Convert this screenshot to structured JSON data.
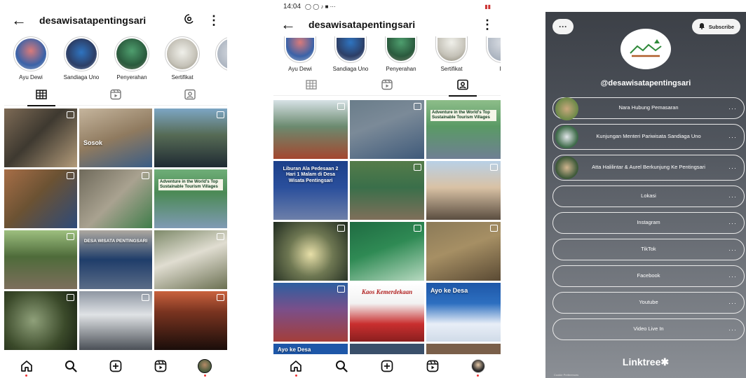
{
  "left_phone": {
    "username": "desawisatapentingsari",
    "highlights": [
      {
        "label": "Ayu Dewi"
      },
      {
        "label": "Sandiaga Uno"
      },
      {
        "label": "Penyerahan"
      },
      {
        "label": "Sertifikat"
      },
      {
        "label": "Pi"
      }
    ],
    "tabs": [
      {
        "icon": "grid-icon",
        "active": true
      },
      {
        "icon": "reels-icon",
        "active": false
      },
      {
        "icon": "tagged-icon",
        "active": false
      }
    ],
    "posts": [
      {
        "overlay": "",
        "caption": ""
      },
      {
        "overlay": "Sosok",
        "caption": ""
      },
      {
        "overlay": "",
        "caption": ""
      },
      {
        "overlay": "",
        "caption": ""
      },
      {
        "overlay": "",
        "caption": ""
      },
      {
        "overlay": "Adventure in the World's Top Sustainable Tourism Villages",
        "caption": ""
      },
      {
        "overlay": "",
        "caption": ""
      },
      {
        "overlay": "DESA WISATA PENTINGSARI",
        "caption": ""
      },
      {
        "overlay": "",
        "caption": ""
      },
      {
        "overlay": "",
        "caption": ""
      },
      {
        "overlay": "",
        "caption": ""
      },
      {
        "overlay": "",
        "caption": ""
      }
    ]
  },
  "right_phone": {
    "status_time": "14:04",
    "username": "desawisatapentingsari",
    "highlights": [
      {
        "label": "Ayu Dewi"
      },
      {
        "label": "Sandiaga Uno"
      },
      {
        "label": "Penyerahan"
      },
      {
        "label": "Sertifikat"
      },
      {
        "label": "Pi"
      }
    ],
    "posts": [
      {
        "overlay": ""
      },
      {
        "overlay": ""
      },
      {
        "overlay": "Adventure in the World's Top Sustainable Tourism Villages"
      },
      {
        "overlay": "Liburan Ala Pedesaan 2 Hari 1 Malam di Desa Wisata Pentingsari"
      },
      {
        "overlay": ""
      },
      {
        "overlay": ""
      },
      {
        "overlay": ""
      },
      {
        "overlay": ""
      },
      {
        "overlay": ""
      },
      {
        "overlay": ""
      },
      {
        "overlay": "Kaos Kemerdekaan"
      },
      {
        "overlay": "Ayo ke Desa"
      },
      {
        "overlay": "Ayo ke Desa"
      },
      {
        "overlay": ""
      },
      {
        "overlay": ""
      }
    ]
  },
  "linktree": {
    "more_label": "···",
    "subscribe_label": "Subscribe",
    "handle": "@desawisatapentingsari",
    "links": [
      {
        "label": "Nara Hubung Pemasaran",
        "thumb": true
      },
      {
        "label": "Kunjungan Menteri Pariwisata Sandiaga Uno",
        "thumb": true
      },
      {
        "label": "Atta Halilintar & Aurel Berkunjung Ke Pentingsari",
        "thumb": true
      },
      {
        "label": "Lokasi",
        "thumb": false
      },
      {
        "label": "Instagram",
        "thumb": false
      },
      {
        "label": "TikTok",
        "thumb": false
      },
      {
        "label": "Facebook",
        "thumb": false
      },
      {
        "label": "Youtube",
        "thumb": false
      },
      {
        "label": "Video Live In",
        "thumb": false
      }
    ],
    "brand": "Linktree✱",
    "cookie": "Cookie Preferences"
  }
}
